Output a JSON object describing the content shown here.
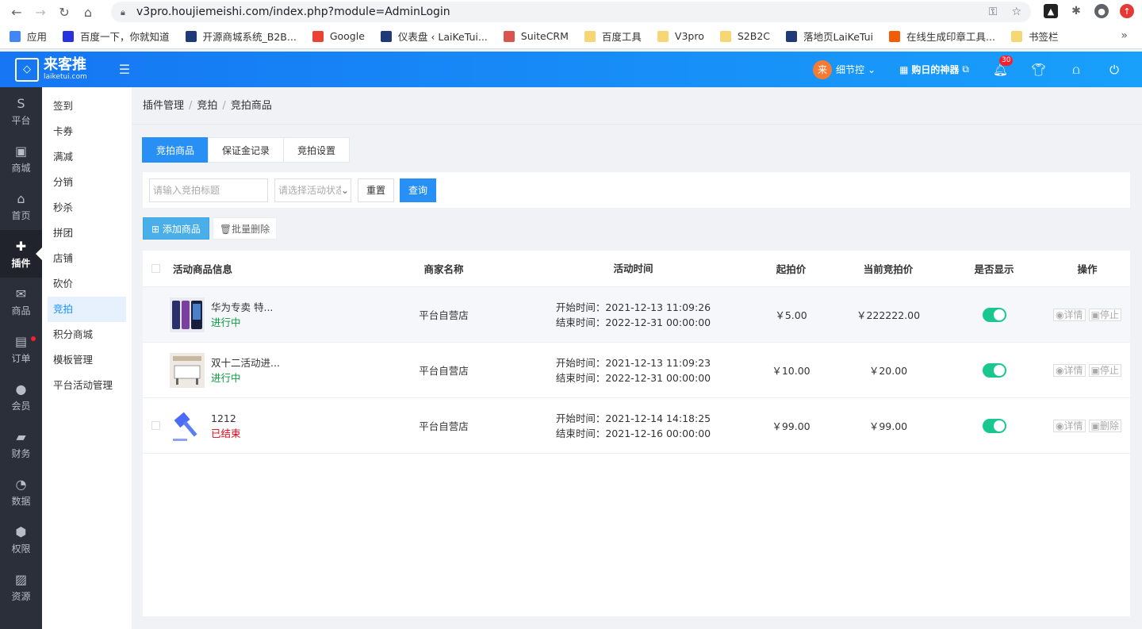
{
  "browser": {
    "url": "v3pro.houjiemeishi.com/index.php?module=AdminLogin",
    "bookmarks": [
      {
        "label": "应用",
        "color": "#4285f4"
      },
      {
        "label": "百度一下，你就知道",
        "color": "#2932e1"
      },
      {
        "label": "开源商城系统_B2B...",
        "color": "#203a77"
      },
      {
        "label": "Google",
        "color": "#ea4335"
      },
      {
        "label": "仪表盘 ‹ LaiKeTui...",
        "color": "#203a77"
      },
      {
        "label": "SuiteCRM",
        "color": "#d9534f"
      },
      {
        "label": "百度工具",
        "color": "#f7d774"
      },
      {
        "label": "V3pro",
        "color": "#f7d774"
      },
      {
        "label": "S2B2C",
        "color": "#f7d774"
      },
      {
        "label": "落地页LaiKeTui",
        "color": "#203a77"
      },
      {
        "label": "在线生成印章工具...",
        "color": "#f25c05"
      },
      {
        "label": "书签栏",
        "color": "#f7d774"
      }
    ],
    "more": "»"
  },
  "header": {
    "logo_name": "来客推",
    "logo_sub": "laiketui.com",
    "user_name": "细节控",
    "avatar_text": "来",
    "shop_link": "购日的神器",
    "notification_count": "30"
  },
  "icon_sidebar": [
    {
      "label": "平台",
      "icon": "S"
    },
    {
      "label": "商城",
      "icon": "▣"
    },
    {
      "label": "首页",
      "icon": "⌂"
    },
    {
      "label": "插件",
      "icon": "✚",
      "active": true
    },
    {
      "label": "商品",
      "icon": "✉"
    },
    {
      "label": "订单",
      "icon": "▤",
      "dot": true
    },
    {
      "label": "会员",
      "icon": "●"
    },
    {
      "label": "财务",
      "icon": "▰"
    },
    {
      "label": "数据",
      "icon": "◔"
    },
    {
      "label": "权限",
      "icon": "⬢"
    },
    {
      "label": "资源",
      "icon": "▨"
    }
  ],
  "sub_menu": [
    "签到",
    "卡券",
    "满减",
    "分销",
    "秒杀",
    "拼团",
    "店铺",
    "砍价",
    "竞拍",
    "积分商城",
    "模板管理",
    "平台活动管理"
  ],
  "sub_menu_active": "竞拍",
  "breadcrumb": [
    "插件管理",
    "竞拍",
    "竞拍商品"
  ],
  "tabs": [
    "竞拍商品",
    "保证金记录",
    "竞拍设置"
  ],
  "filter": {
    "title_placeholder": "请输入竞拍标题",
    "status_placeholder": "请选择活动状态",
    "reset": "重置",
    "query": "查询"
  },
  "actions": {
    "add": "添加商品",
    "batch_delete": "批量删除"
  },
  "table": {
    "headers": [
      "活动商品信息",
      "商家名称",
      "活动时间",
      "起拍价",
      "当前竞拍价",
      "是否显示",
      "操作"
    ],
    "rows": [
      {
        "name": "华为专卖 特...",
        "status": "进行中",
        "shop": "平台自营店",
        "start": "开始时间：2021-12-13 11:09:26",
        "end": "结束时间：2022-12-31 00:00:00",
        "start_price": "￥5.00",
        "current_price": "￥222222.00",
        "op1": "详情",
        "op2": "停止"
      },
      {
        "name": "双十二活动进...",
        "status": "进行中",
        "shop": "平台自营店",
        "start": "开始时间：2021-12-13 11:09:23",
        "end": "结束时间：2022-12-31 00:00:00",
        "start_price": "￥10.00",
        "current_price": "￥20.00",
        "op1": "详情",
        "op2": "停止"
      },
      {
        "name": "1212",
        "status": "已结束",
        "shop": "平台自营店",
        "start": "开始时间：2021-12-14 14:18:25",
        "end": "结束时间：2021-12-16 00:00:00",
        "start_price": "￥99.00",
        "current_price": "￥99.00",
        "op1": "详情",
        "op2": "删除"
      }
    ]
  }
}
